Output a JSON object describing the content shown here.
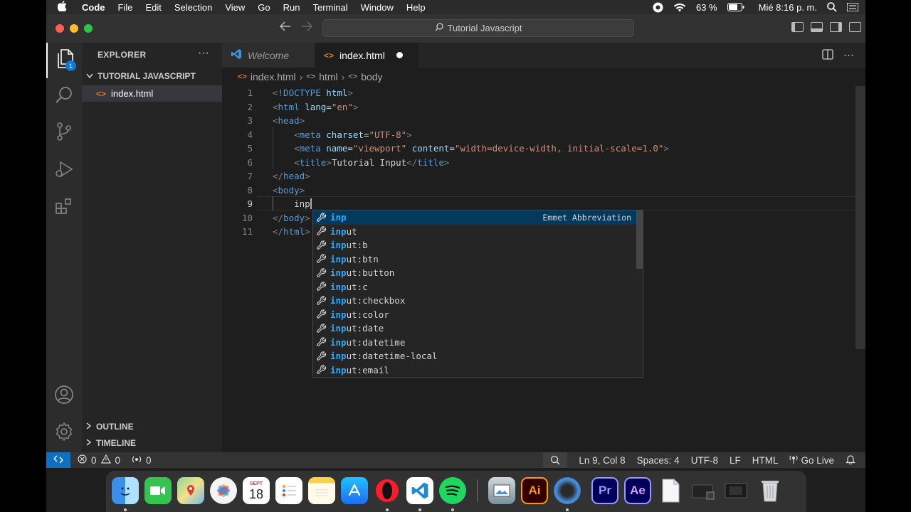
{
  "menubar": {
    "app_name": "Code",
    "items": [
      "File",
      "Edit",
      "Selection",
      "View",
      "Go",
      "Run",
      "Terminal",
      "Window",
      "Help"
    ],
    "battery": "63 %",
    "clock": "Mié 8:16 p. m."
  },
  "titlebar": {
    "search_text": "Tutorial Javascript"
  },
  "activity_bar": {
    "explorer_badge": "1",
    "icons": [
      "explorer-icon",
      "search-icon",
      "source-control-icon",
      "run-debug-icon",
      "extensions-icon",
      "account-icon",
      "settings-gear-icon"
    ]
  },
  "sidebar": {
    "title": "EXPLORER",
    "more": "···",
    "folder": "TUTORIAL JAVASCRIPT",
    "files": [
      "index.html"
    ],
    "outline": "OUTLINE",
    "timeline": "TIMELINE"
  },
  "tabs": [
    {
      "label": "Welcome"
    },
    {
      "label": "index.html"
    }
  ],
  "breadcrumb": [
    "index.html",
    "html",
    "body"
  ],
  "editor": {
    "line_numbers": [
      "1",
      "2",
      "3",
      "4",
      "5",
      "6",
      "7",
      "8",
      "9",
      "10",
      "11"
    ],
    "current_line": 9,
    "typed": "inp"
  },
  "suggest": {
    "items": [
      {
        "match": "inp",
        "rest": ""
      },
      {
        "match": "inp",
        "rest": "ut"
      },
      {
        "match": "inp",
        "rest": "ut:b"
      },
      {
        "match": "inp",
        "rest": "ut:btn"
      },
      {
        "match": "inp",
        "rest": "ut:button"
      },
      {
        "match": "inp",
        "rest": "ut:c"
      },
      {
        "match": "inp",
        "rest": "ut:checkbox"
      },
      {
        "match": "inp",
        "rest": "ut:color"
      },
      {
        "match": "inp",
        "rest": "ut:date"
      },
      {
        "match": "inp",
        "rest": "ut:datetime"
      },
      {
        "match": "inp",
        "rest": "ut:datetime-local"
      },
      {
        "match": "inp",
        "rest": "ut:email"
      }
    ],
    "detail": "Emmet Abbreviation"
  },
  "statusbar": {
    "errors": "0",
    "warnings": "0",
    "ports": "0",
    "position": "Ln 9, Col 8",
    "spaces": "Spaces: 4",
    "encoding": "UTF-8",
    "eol": "LF",
    "language": "HTML",
    "golive": "Go Live"
  },
  "dock": {
    "calendar_month": "SEPT",
    "calendar_day": "18",
    "illustrator_label": "Ai",
    "premiere_label": "Pr",
    "aftereffects_label": "Ae"
  },
  "colors": {
    "accent": "#0e70c0",
    "tag": "#569cd6",
    "attribute": "#9cdcfe",
    "string": "#ce9178",
    "match": "#2aaaff"
  }
}
